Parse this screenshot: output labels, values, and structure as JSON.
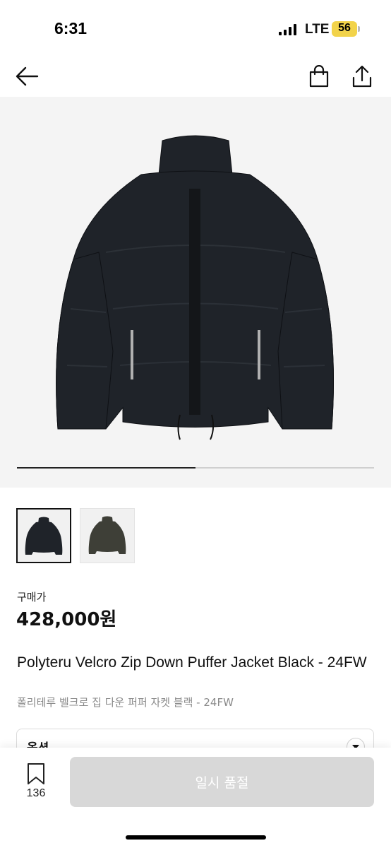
{
  "status": {
    "time": "6:31",
    "network": "LTE",
    "battery": "56"
  },
  "nav": {
    "back_icon": "arrow-left-icon",
    "bag_icon": "shopping-bag-icon",
    "share_icon": "share-icon"
  },
  "gallery": {
    "current_index": 1,
    "total": 2,
    "progress": 0.5
  },
  "product": {
    "price_label": "구매가",
    "price": "428,000원",
    "title_en": "Polyteru Velcro Zip Down Puffer Jacket Black - 24FW",
    "title_ko": "폴리테루 벨크로 집 다운 퍼퍼 자켓 블랙 - 24FW"
  },
  "option": {
    "label": "옵션"
  },
  "bottom": {
    "wish_count": "136",
    "action_label": "일시 품절"
  },
  "colors": {
    "accent": "#111111",
    "disabled_button": "#d8d8d8",
    "hero_bg": "#f4f4f4"
  }
}
